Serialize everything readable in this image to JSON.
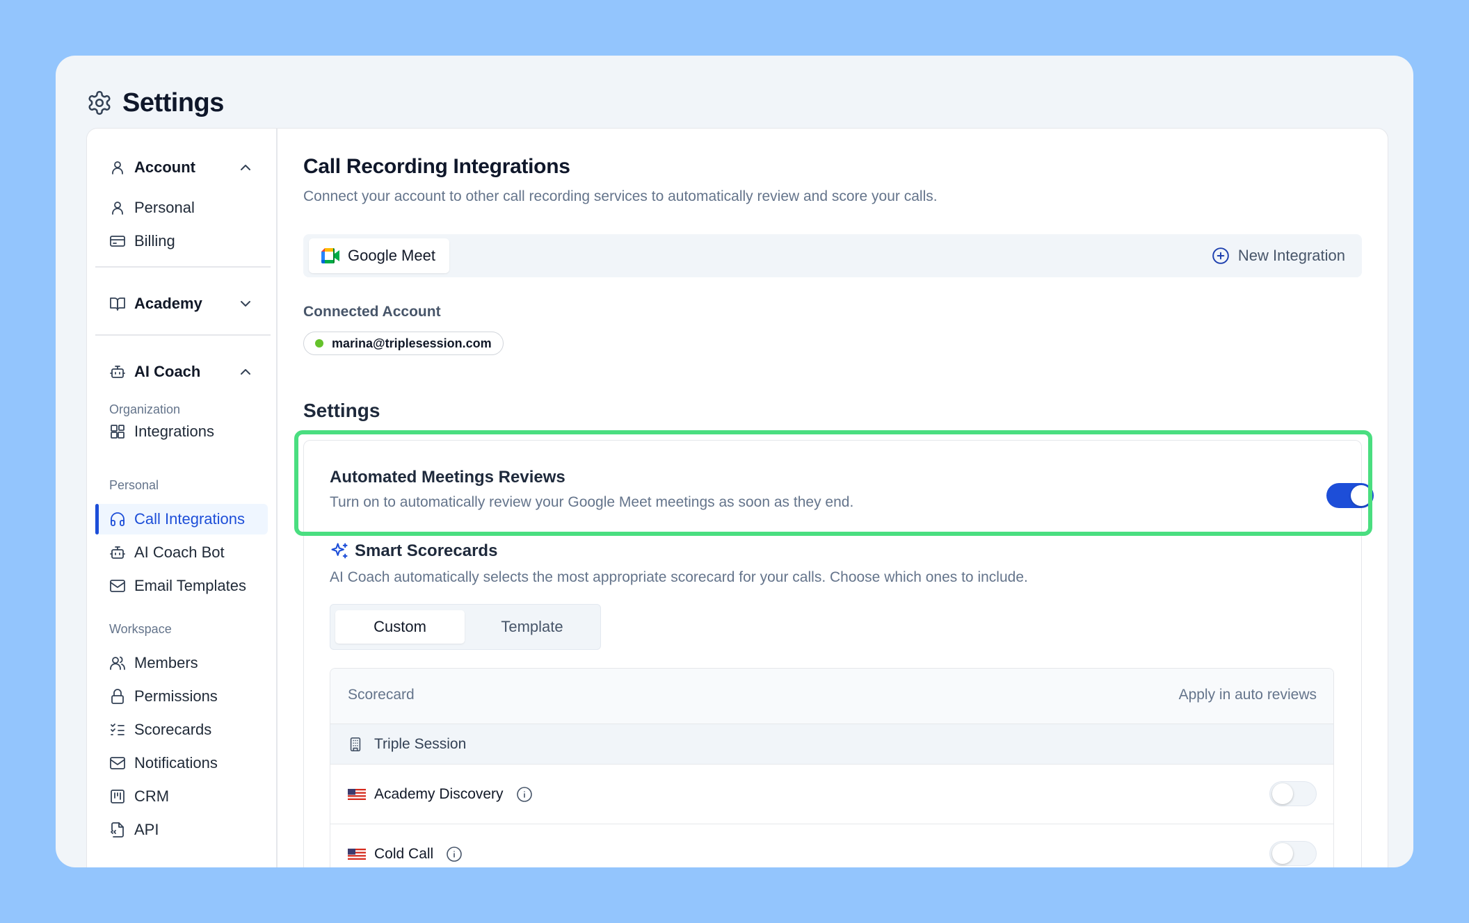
{
  "header": {
    "title": "Settings"
  },
  "sidebar": {
    "groups": [
      {
        "label": "Account",
        "icon": "user-icon",
        "expanded": true
      },
      {
        "label": "Academy",
        "icon": "book-icon",
        "expanded": false
      },
      {
        "label": "AI Coach",
        "icon": "bot-icon",
        "expanded": true
      }
    ],
    "account_items": [
      {
        "label": "Personal",
        "icon": "user-icon"
      },
      {
        "label": "Billing",
        "icon": "credit-card-icon"
      }
    ],
    "sections": {
      "organization": "Organization",
      "personal": "Personal",
      "workspace": "Workspace"
    },
    "organization_items": [
      {
        "label": "Integrations",
        "icon": "blocks-icon"
      }
    ],
    "personal_items": [
      {
        "label": "Call Integrations",
        "icon": "headphones-icon",
        "active": true
      },
      {
        "label": "AI Coach Bot",
        "icon": "bot-icon"
      },
      {
        "label": "Email Templates",
        "icon": "mail-icon"
      }
    ],
    "workspace_items": [
      {
        "label": "Members",
        "icon": "users-icon"
      },
      {
        "label": "Permissions",
        "icon": "lock-icon"
      },
      {
        "label": "Scorecards",
        "icon": "list-checks-icon"
      },
      {
        "label": "Notifications",
        "icon": "mail-icon"
      },
      {
        "label": "CRM",
        "icon": "kanban-icon"
      },
      {
        "label": "API",
        "icon": "file-code-icon"
      }
    ]
  },
  "main": {
    "title": "Call Recording Integrations",
    "subtitle": "Connect your account to other call recording services to automatically review and score your calls.",
    "tabs": [
      {
        "label": "Google Meet",
        "icon": "google-meet-icon",
        "selected": true
      }
    ],
    "new_integration_label": "New Integration",
    "connected_account_label": "Connected Account",
    "connected_account_email": "marina@triplesession.com",
    "connected_status_color": "#65c22b",
    "settings_heading": "Settings",
    "automated_reviews": {
      "title": "Automated Meetings Reviews",
      "description": "Turn on to automatically review your Google Meet meetings as soon as they end.",
      "enabled": true
    },
    "smart_scorecards": {
      "title": "Smart Scorecards",
      "description": "AI Coach automatically selects the most appropriate scorecard for your calls. Choose which ones to include.",
      "segments": [
        "Custom",
        "Template"
      ],
      "selected_segment": "Custom"
    },
    "table": {
      "col_scorecard": "Scorecard",
      "col_apply": "Apply in auto reviews",
      "group": "Triple Session",
      "rows": [
        {
          "name": "Academy Discovery",
          "enabled": false
        },
        {
          "name": "Cold Call",
          "enabled": false
        }
      ]
    }
  },
  "colors": {
    "accent": "#1d4ed8",
    "highlight": "#4ade80",
    "background": "#93c5fd"
  }
}
